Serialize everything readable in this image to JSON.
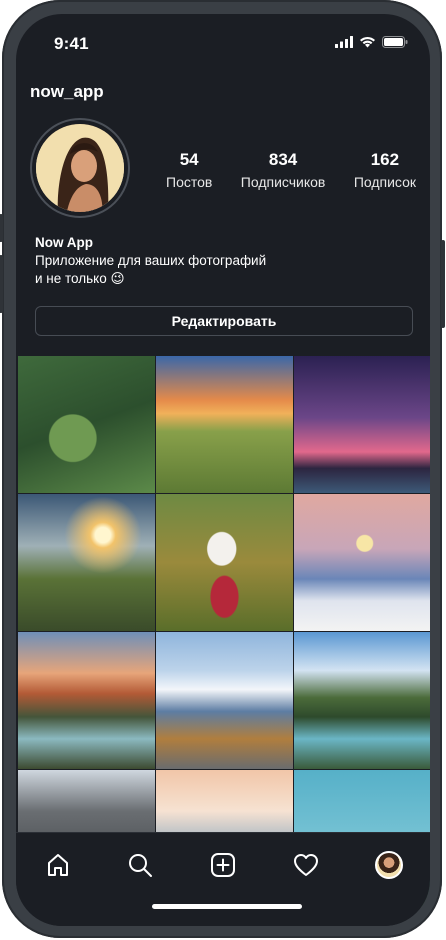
{
  "status_bar": {
    "time": "9:41"
  },
  "profile": {
    "username": "now_app",
    "display_name": "Now App",
    "bio_line1": "Приложение для ваших фотографий",
    "bio_line2": "и не только 😉",
    "stats": [
      {
        "value": "54",
        "label": "Постов"
      },
      {
        "value": "834",
        "label": "Подписчиков"
      },
      {
        "value": "162",
        "label": "Подписок"
      }
    ],
    "edit_button_label": "Редактировать"
  },
  "tabbar": {
    "items": [
      {
        "icon": "home-icon"
      },
      {
        "icon": "search-icon"
      },
      {
        "icon": "add-post-icon"
      },
      {
        "icon": "heart-icon"
      },
      {
        "icon": "profile-avatar"
      }
    ]
  },
  "colors": {
    "background": "#1b1e24",
    "text": "#ffffff",
    "border": "#474c54"
  }
}
